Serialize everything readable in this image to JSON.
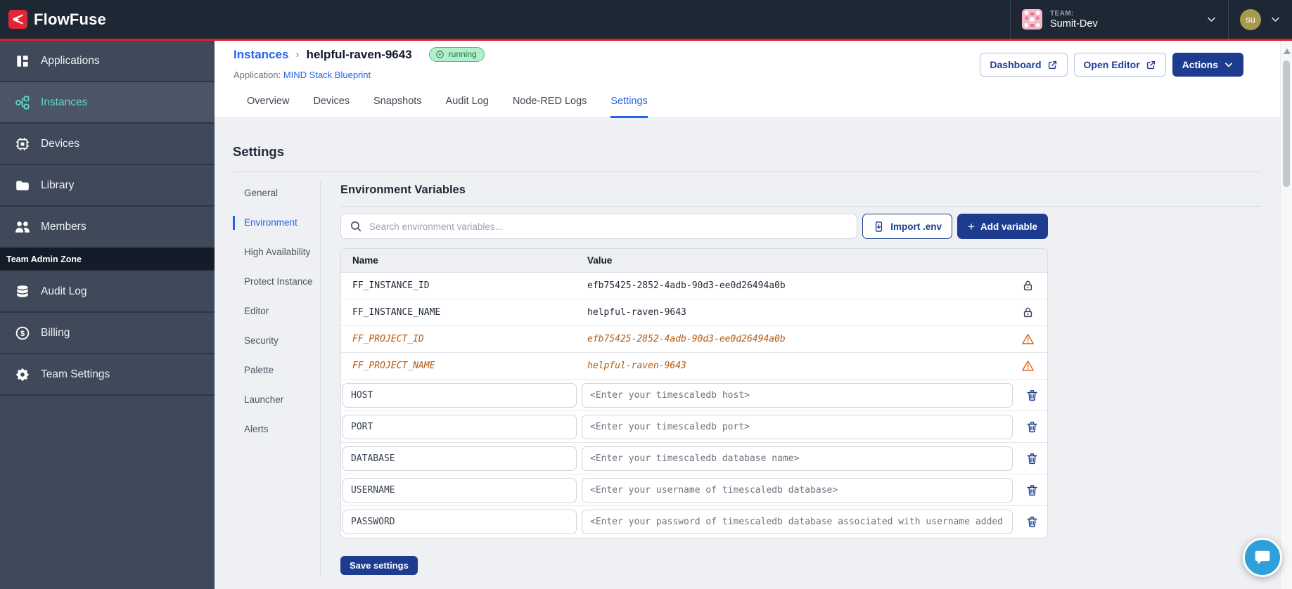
{
  "topbar": {
    "brand": "FlowFuse",
    "team_label": "TEAM:",
    "team_name": "Sumit-Dev",
    "user_initials": "su"
  },
  "sidebar": {
    "items": [
      {
        "label": "Applications",
        "icon": "applications-icon",
        "active": false
      },
      {
        "label": "Instances",
        "icon": "instances-icon",
        "active": true
      },
      {
        "label": "Devices",
        "icon": "devices-icon",
        "active": false
      },
      {
        "label": "Library",
        "icon": "library-icon",
        "active": false
      },
      {
        "label": "Members",
        "icon": "members-icon",
        "active": false
      }
    ],
    "admin_zone_label": "Team Admin Zone",
    "admin_items": [
      {
        "label": "Audit Log",
        "icon": "audit-log-icon",
        "active": false
      },
      {
        "label": "Billing",
        "icon": "billing-icon",
        "active": false
      },
      {
        "label": "Team Settings",
        "icon": "team-settings-icon",
        "active": false
      }
    ]
  },
  "header": {
    "breadcrumb_parent": "Instances",
    "breadcrumb_separator": "›",
    "breadcrumb_current": "helpful-raven-9643",
    "status_badge": "running",
    "application_label": "Application:",
    "application_name": "MIND Stack Blueprint",
    "dashboard_button": "Dashboard",
    "open_editor_button": "Open Editor",
    "actions_button": "Actions"
  },
  "tabs": [
    {
      "label": "Overview",
      "active": false
    },
    {
      "label": "Devices",
      "active": false
    },
    {
      "label": "Snapshots",
      "active": false
    },
    {
      "label": "Audit Log",
      "active": false
    },
    {
      "label": "Node-RED Logs",
      "active": false
    },
    {
      "label": "Settings",
      "active": true
    }
  ],
  "settings": {
    "title": "Settings",
    "nav": [
      {
        "label": "General",
        "active": false
      },
      {
        "label": "Environment",
        "active": true
      },
      {
        "label": "High Availability",
        "active": false
      },
      {
        "label": "Protect Instance",
        "active": false
      },
      {
        "label": "Editor",
        "active": false
      },
      {
        "label": "Security",
        "active": false
      },
      {
        "label": "Palette",
        "active": false
      },
      {
        "label": "Launcher",
        "active": false
      },
      {
        "label": "Alerts",
        "active": false
      }
    ],
    "panel": {
      "title": "Environment Variables",
      "search_placeholder": "Search environment variables...",
      "import_button": "Import .env",
      "add_button": "Add variable",
      "table": {
        "columns": [
          "Name",
          "Value"
        ],
        "locked_rows": [
          {
            "name": "FF_INSTANCE_ID",
            "value": "efb75425-2852-4adb-90d3-ee0d26494a0b",
            "state": "locked"
          },
          {
            "name": "FF_INSTANCE_NAME",
            "value": "helpful-raven-9643",
            "state": "locked"
          },
          {
            "name": "FF_PROJECT_ID",
            "value": "efb75425-2852-4adb-90d3-ee0d26494a0b",
            "state": "deprecated"
          },
          {
            "name": "FF_PROJECT_NAME",
            "value": "helpful-raven-9643",
            "state": "deprecated"
          }
        ],
        "editable_rows": [
          {
            "name": "HOST",
            "placeholder": "<Enter your timescaledb host>"
          },
          {
            "name": "PORT",
            "placeholder": "<Enter your timescaledb port>"
          },
          {
            "name": "DATABASE",
            "placeholder": "<Enter your timescaledb database name>"
          },
          {
            "name": "USERNAME",
            "placeholder": "<Enter your username of timescaledb database>"
          },
          {
            "name": "PASSWORD",
            "placeholder": "<Enter your password of timescaledb database associated with username added"
          }
        ]
      },
      "save_button": "Save settings"
    }
  },
  "colors": {
    "topbar_bg": "#1e2734",
    "accent_red": "#d8222f",
    "sidebar_bg": "#3f4959",
    "active_teal": "#66d6c6",
    "link_blue": "#2563eb",
    "button_navy": "#1d3c8f",
    "running_badge_bg": "#b4eecb",
    "running_badge_text": "#177a45",
    "deprecated_orange": "#b35a10",
    "warning_orange": "#e2641c",
    "chat_blue": "#2fa0da"
  }
}
